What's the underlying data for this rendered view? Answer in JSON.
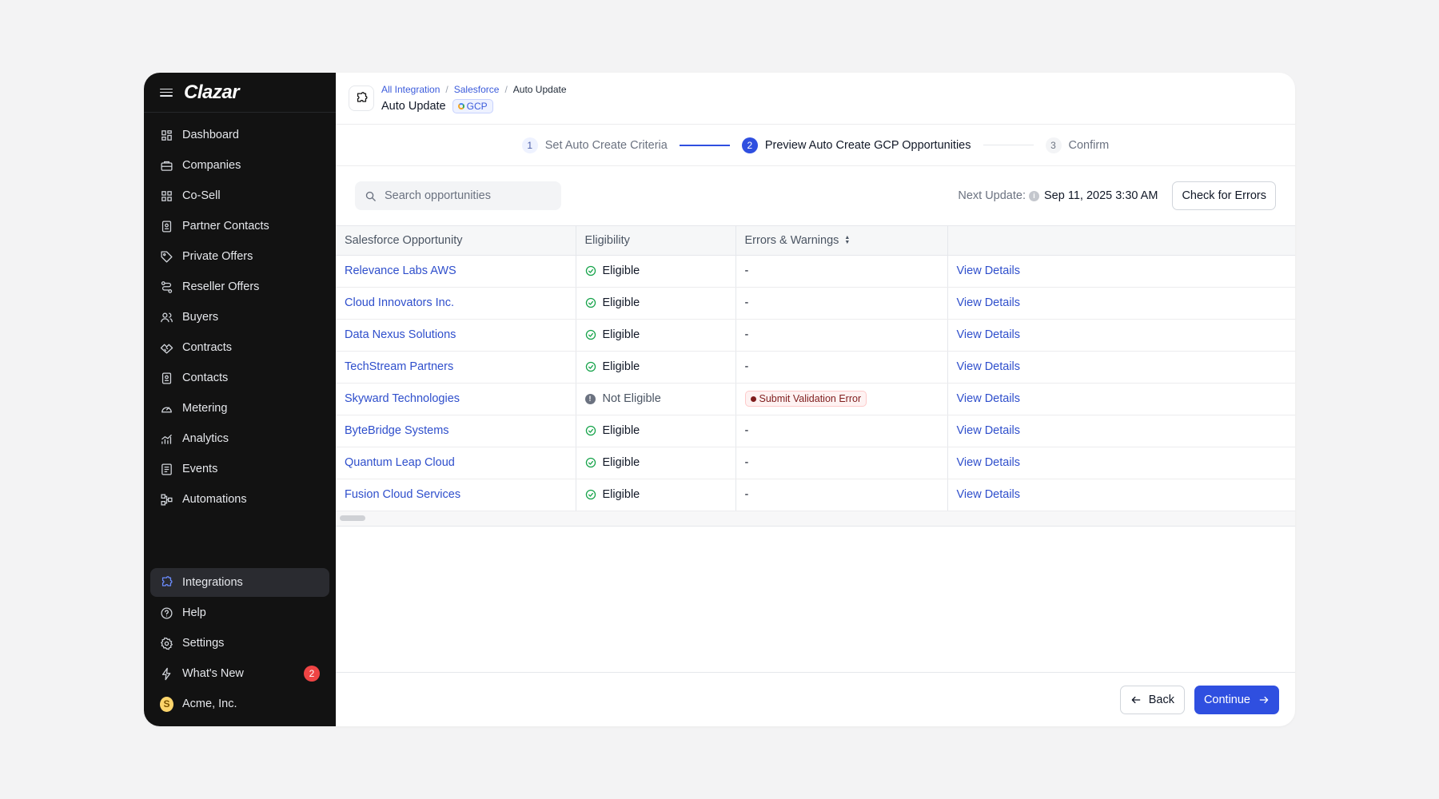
{
  "sidebar": {
    "brand": "Clazar",
    "items": [
      {
        "label": "Dashboard",
        "icon": "dashboard-icon"
      },
      {
        "label": "Companies",
        "icon": "briefcase-icon"
      },
      {
        "label": "Co-Sell",
        "icon": "grid-icon"
      },
      {
        "label": "Partner Contacts",
        "icon": "contact-card-icon"
      },
      {
        "label": "Private Offers",
        "icon": "tag-icon"
      },
      {
        "label": "Reseller Offers",
        "icon": "route-icon"
      },
      {
        "label": "Buyers",
        "icon": "users-icon"
      },
      {
        "label": "Contracts",
        "icon": "handshake-icon"
      },
      {
        "label": "Contacts",
        "icon": "contact-card-icon"
      },
      {
        "label": "Metering",
        "icon": "gauge-icon"
      },
      {
        "label": "Analytics",
        "icon": "chart-icon"
      },
      {
        "label": "Events",
        "icon": "list-icon"
      },
      {
        "label": "Automations",
        "icon": "workflow-icon"
      }
    ],
    "bottom": [
      {
        "label": "Integrations",
        "icon": "puzzle-icon",
        "active": true
      },
      {
        "label": "Help",
        "icon": "help-icon"
      },
      {
        "label": "Settings",
        "icon": "gear-icon"
      },
      {
        "label": "What's New",
        "icon": "bolt-icon",
        "badge": "2"
      },
      {
        "label": "Acme, Inc.",
        "avatar": "S"
      }
    ]
  },
  "header": {
    "breadcrumbs": [
      "All Integration",
      "Salesforce",
      "Auto Update"
    ],
    "title": "Auto Update",
    "badge": "GCP"
  },
  "stepper": [
    {
      "num": "1",
      "label": "Set Auto Create Criteria",
      "state": "done"
    },
    {
      "num": "2",
      "label": "Preview Auto Create GCP Opportunities",
      "state": "active"
    },
    {
      "num": "3",
      "label": "Confirm",
      "state": "todo"
    }
  ],
  "toolbar": {
    "search_placeholder": "Search opportunities",
    "next_update_label": "Next Update:",
    "next_update_value": "Sep 11, 2025 3:30 AM",
    "check_errors_label": "Check for Errors"
  },
  "table": {
    "columns": [
      "Salesforce Opportunity",
      "Eligibility",
      "Errors & Warnings",
      ""
    ],
    "rows": [
      {
        "name": "Relevance Labs AWS",
        "eligibility": "Eligible",
        "eligible": true,
        "errors": "-",
        "action": "View Details"
      },
      {
        "name": "Cloud Innovators Inc.",
        "eligibility": "Eligible",
        "eligible": true,
        "errors": "-",
        "action": "View Details"
      },
      {
        "name": "Data Nexus Solutions",
        "eligibility": "Eligible",
        "eligible": true,
        "errors": "-",
        "action": "View Details"
      },
      {
        "name": "TechStream Partners",
        "eligibility": "Eligible",
        "eligible": true,
        "errors": "-",
        "action": "View Details"
      },
      {
        "name": "Skyward Technologies",
        "eligibility": "Not Eligible",
        "eligible": false,
        "errors": "Submit Validation Error",
        "action": "View Details"
      },
      {
        "name": "ByteBridge Systems",
        "eligibility": "Eligible",
        "eligible": true,
        "errors": "-",
        "action": "View Details"
      },
      {
        "name": "Quantum Leap Cloud",
        "eligibility": "Eligible",
        "eligible": true,
        "errors": "-",
        "action": "View Details"
      },
      {
        "name": "Fusion Cloud Services",
        "eligibility": "Eligible",
        "eligible": true,
        "errors": "-",
        "action": "View Details"
      }
    ]
  },
  "footer": {
    "back_label": "Back",
    "continue_label": "Continue"
  },
  "colors": {
    "accent": "#2f4fe0",
    "sidebar_bg": "#121212",
    "success": "#16a34a",
    "error": "#7f1d1d"
  }
}
